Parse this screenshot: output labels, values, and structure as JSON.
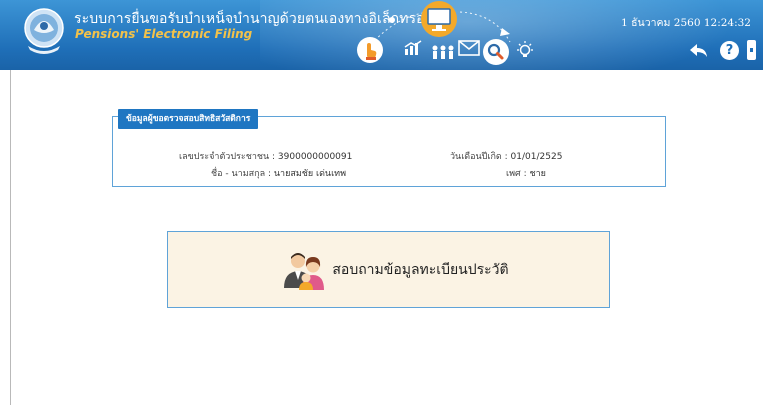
{
  "header": {
    "title_th": "ระบบการยื่นขอรับบำเหน็จบำนาญด้วยตนเองทางอิเล็กทรอนิกส์",
    "title_en": "Pensions' Electronic Filing",
    "datetime": "1 ธันวาคม 2560 12:24:32",
    "help_label": "?",
    "icons": [
      "hand-touch-icon",
      "chart-icon",
      "people-icon",
      "monitor-icon",
      "mail-icon",
      "magnifier-icon",
      "lightbulb-icon"
    ]
  },
  "info_panel": {
    "legend": "ข้อมูลผู้ขอตรวจสอบสิทธิสวัสดิการ",
    "id_label": "เลขประจำตัวประชาชน :",
    "id_value": "3900000000091",
    "birth_label": "วันเดือนปีเกิด :",
    "birth_value": "01/01/2525",
    "name_label": "ชื่อ - นามสกุล :",
    "name_value": "นายสมชัย เด่นเทพ",
    "sex_label": "เพศ :",
    "sex_value": "ชาย"
  },
  "action": {
    "label": "สอบถามข้อมูลทะเบียนประวัติ"
  },
  "colors": {
    "header": "#1f6fb8",
    "accent": "#1f76c2",
    "title_en": "#f3c24a",
    "action_bg": "#fbf3e4",
    "border": "#5fa3d8"
  }
}
